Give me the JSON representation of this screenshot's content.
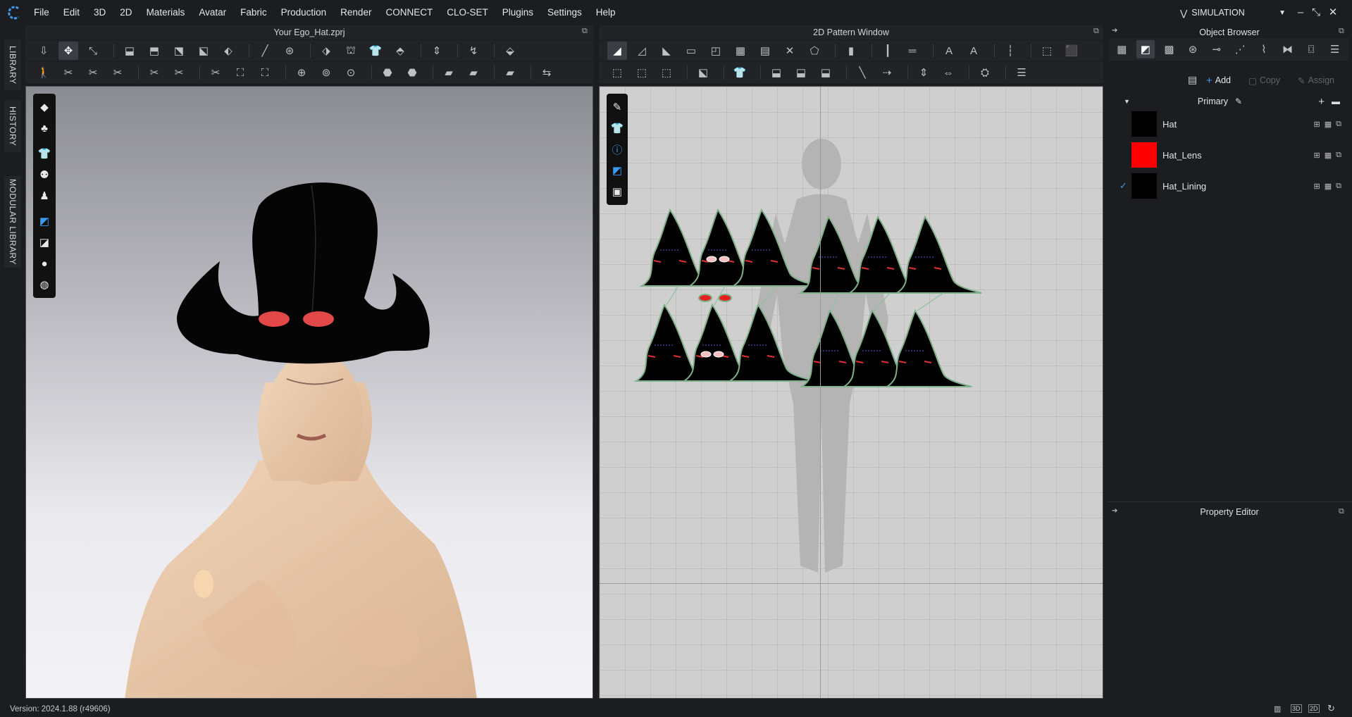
{
  "menubar": {
    "logo_icon": "clo-logo-icon",
    "items": [
      "File",
      "Edit",
      "3D",
      "2D",
      "Materials",
      "Avatar",
      "Fabric",
      "Production",
      "Render",
      "CONNECT",
      "CLO-SET",
      "Plugins",
      "Settings",
      "Help"
    ],
    "mode": "SIMULATION",
    "mode_icon": "simulation-icon"
  },
  "left_tabs": [
    "LIBRARY",
    "HISTORY",
    "MODULAR LIBRARY"
  ],
  "view3d": {
    "title": "Your Ego_Hat.zprj"
  },
  "view2d": {
    "title": "2D Pattern Window"
  },
  "object_browser": {
    "title": "Object Browser",
    "add_label": "Add",
    "copy_label": "Copy",
    "assign_label": "Assign",
    "colorway": "Primary",
    "materials": [
      {
        "name": "Hat",
        "color": "#000000",
        "checked": false
      },
      {
        "name": "Hat_Lens",
        "color": "#ff0000",
        "checked": false
      },
      {
        "name": "Hat_Lining",
        "color": "#000000",
        "checked": true
      }
    ]
  },
  "property_editor": {
    "title": "Property Editor"
  },
  "status": {
    "version": "Version: 2024.1.88 (r49606)"
  },
  "colors": {
    "accent": "#3a9bf0",
    "background": "#1c1d20",
    "lens": "#ff0000"
  }
}
